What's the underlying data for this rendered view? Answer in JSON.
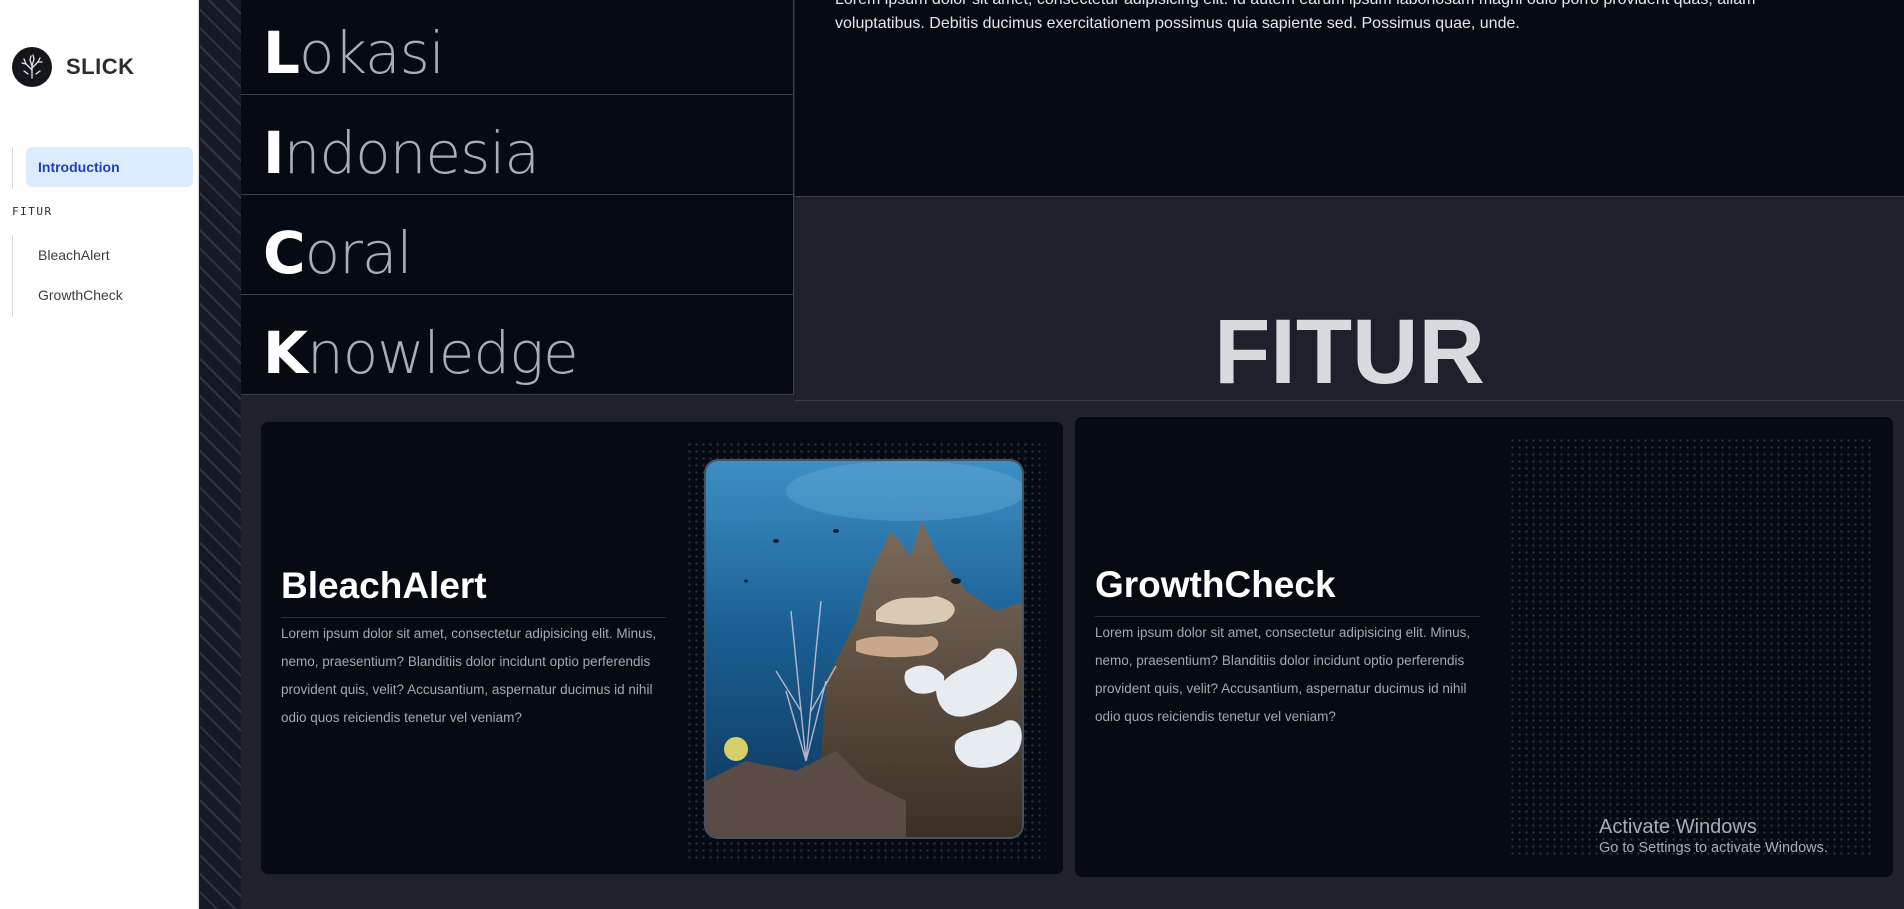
{
  "sidebar": {
    "brand": "SLICK",
    "items": [
      {
        "label": "Introduction",
        "active": true
      }
    ],
    "section_label": "FITUR",
    "feature_items": [
      {
        "label": "BleachAlert"
      },
      {
        "label": "GrowthCheck"
      }
    ]
  },
  "acronym": [
    {
      "first": "L",
      "rest": "okasi"
    },
    {
      "first": "I",
      "rest": "ndonesia"
    },
    {
      "first": "C",
      "rest": "oral"
    },
    {
      "first": "K",
      "rest": "nowledge"
    }
  ],
  "intro": {
    "text": "Lorem ipsum dolor sit amet, consectetur adipisicing elit. Id autem earum ipsum laboriosam magni odio porro provident quas, aliam voluptatibus. Debitis ducimus exercitationem possimus quia sapiente sed. Possimus quae, unde."
  },
  "fitur": {
    "title": "FITUR"
  },
  "cards": [
    {
      "title": "BleachAlert",
      "body": "Lorem ipsum dolor sit amet, consectetur adipisicing elit. Minus, nemo, praesentium? Blanditiis dolor incidunt optio perferendis provident quis, velit? Accusantium, aspernatur ducimus id nihil odio quos reiciendis tenetur vel veniam?"
    },
    {
      "title": "GrowthCheck",
      "body": "Lorem ipsum dolor sit amet, consectetur adipisicing elit. Minus, nemo, praesentium? Blanditiis dolor incidunt optio perferendis provident quis, velit? Accusantium, aspernatur ducimus id nihil odio quos reiciendis tenetur vel veniam?"
    }
  ],
  "watermark": {
    "line1": "Activate Windows",
    "line2": "Go to Settings to activate Windows."
  },
  "colors": {
    "sidebar_active_bg": "#dcecff",
    "sidebar_active_text": "#1e3fb8",
    "page_bg": "#1f222c",
    "panel_bg": "#060a12"
  }
}
